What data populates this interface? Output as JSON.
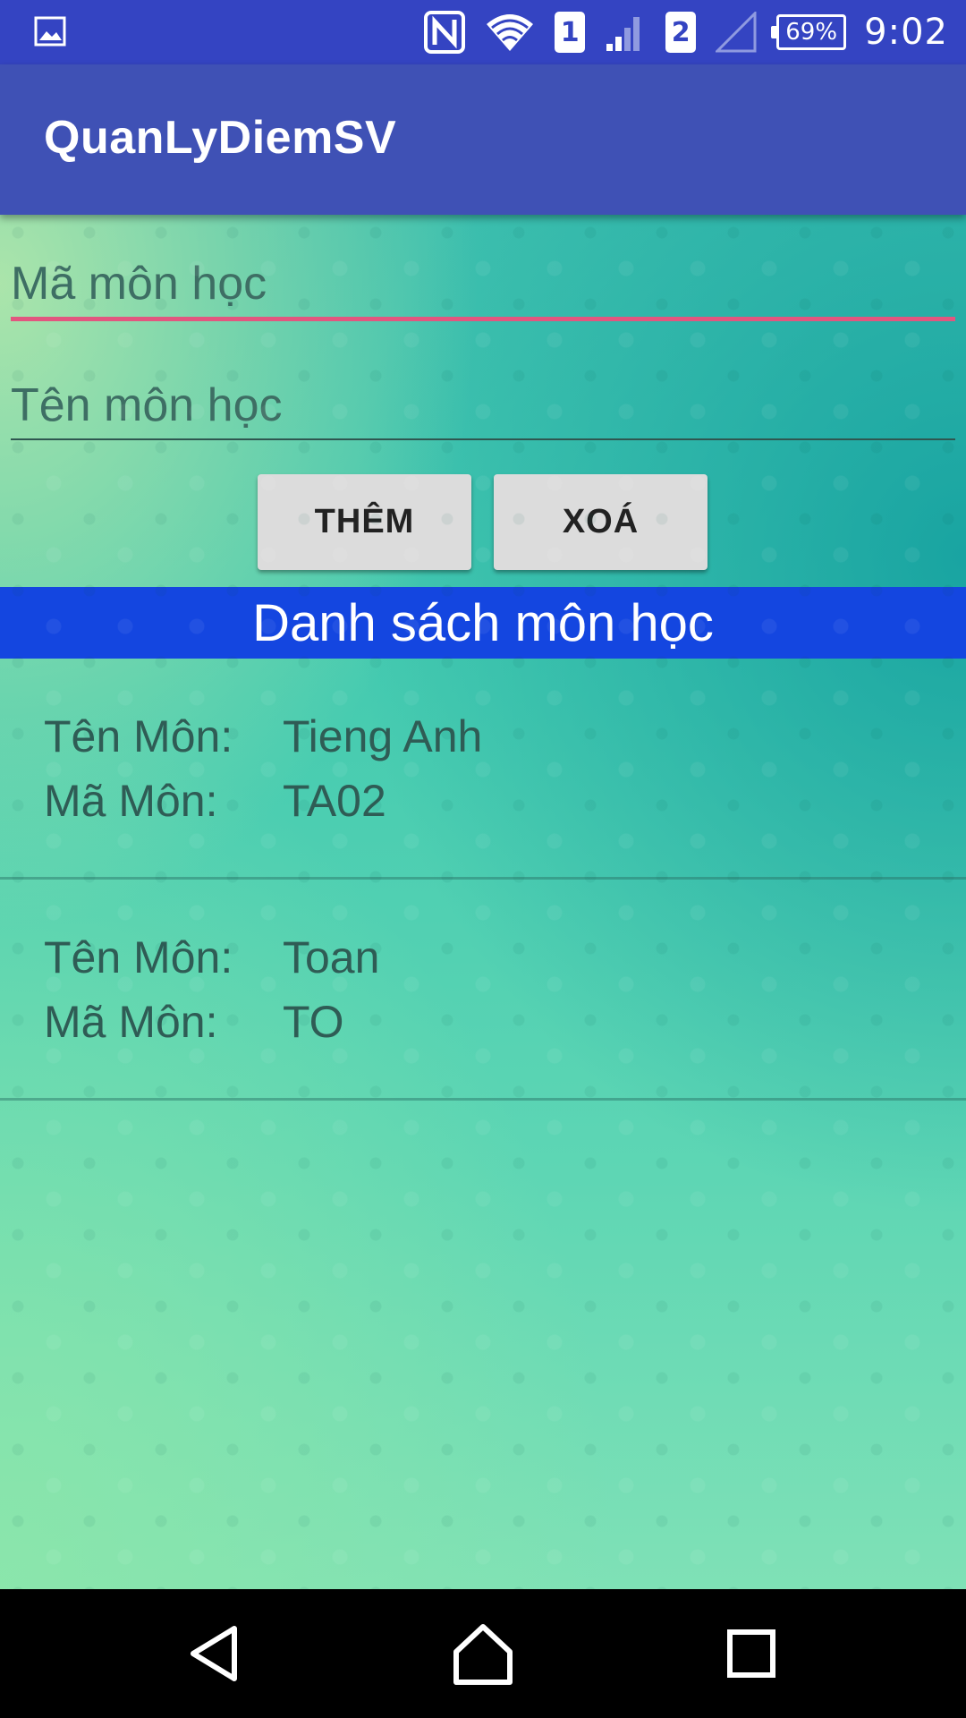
{
  "status_bar": {
    "sim1": "1",
    "sim2": "2",
    "battery": "69%",
    "time": "9:02",
    "icons": [
      "image-icon",
      "nfc-icon",
      "wifi-icon",
      "signal-icon",
      "signal-empty-icon",
      "battery-icon"
    ]
  },
  "app_bar": {
    "title": "QuanLyDiemSV"
  },
  "form": {
    "ma_placeholder": "Mã môn học",
    "ten_placeholder": "Tên môn học",
    "add_label": "THÊM",
    "delete_label": "XOÁ"
  },
  "list_header": "Danh sách môn học",
  "subjects": [
    {
      "ten_label": "Tên Môn:",
      "ten": "Tieng Anh",
      "ma_label": "Mã Môn:",
      "ma": "TA02"
    },
    {
      "ten_label": "Tên Môn:",
      "ten": "Toan",
      "ma_label": "Mã Môn:",
      "ma": "TO"
    }
  ],
  "colors": {
    "status_bar": "#3444c2",
    "app_bar": "#3f51b5",
    "accent": "#e2567f",
    "list_header": "#1446e0"
  }
}
